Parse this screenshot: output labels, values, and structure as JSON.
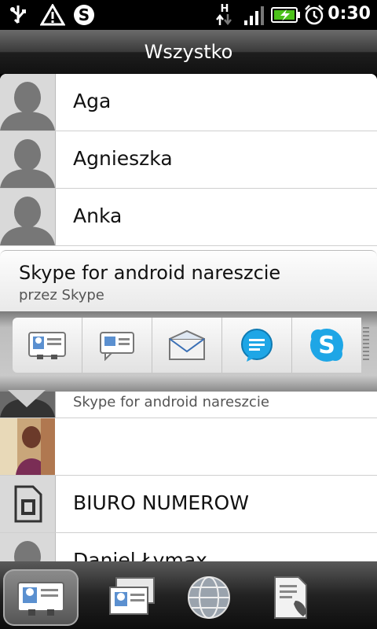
{
  "status": {
    "time": "0:30",
    "network_type": "H",
    "icons": [
      "usb-icon",
      "warning-icon",
      "skype-status-icon",
      "network-arrows-icon",
      "signal-icon",
      "battery-charging-icon",
      "alarm-icon"
    ]
  },
  "header": {
    "title": "Wszystko"
  },
  "contacts": [
    {
      "name": "Aga"
    },
    {
      "name": "Agnieszka"
    },
    {
      "name": "Anka"
    },
    {
      "name": "",
      "status": "Skype for android nareszcie"
    },
    {
      "name": ""
    },
    {
      "name": "BIURO NUMEROW"
    },
    {
      "name": "Daniel Łymax"
    }
  ],
  "popup": {
    "title": "Skype for android nareszcie",
    "subtitle": "przez Skype",
    "actions": [
      "contact-card-icon",
      "message-icon",
      "email-icon",
      "chat-bubble-icon",
      "skype-icon"
    ]
  },
  "tabs": [
    {
      "icon": "contact-card-icon",
      "active": true
    },
    {
      "icon": "groups-icon",
      "active": false
    },
    {
      "icon": "globe-icon",
      "active": false
    },
    {
      "icon": "call-history-icon",
      "active": false
    }
  ],
  "colors": {
    "skype_blue": "#1ea6e6",
    "header_dark": "#1e1e1e"
  }
}
